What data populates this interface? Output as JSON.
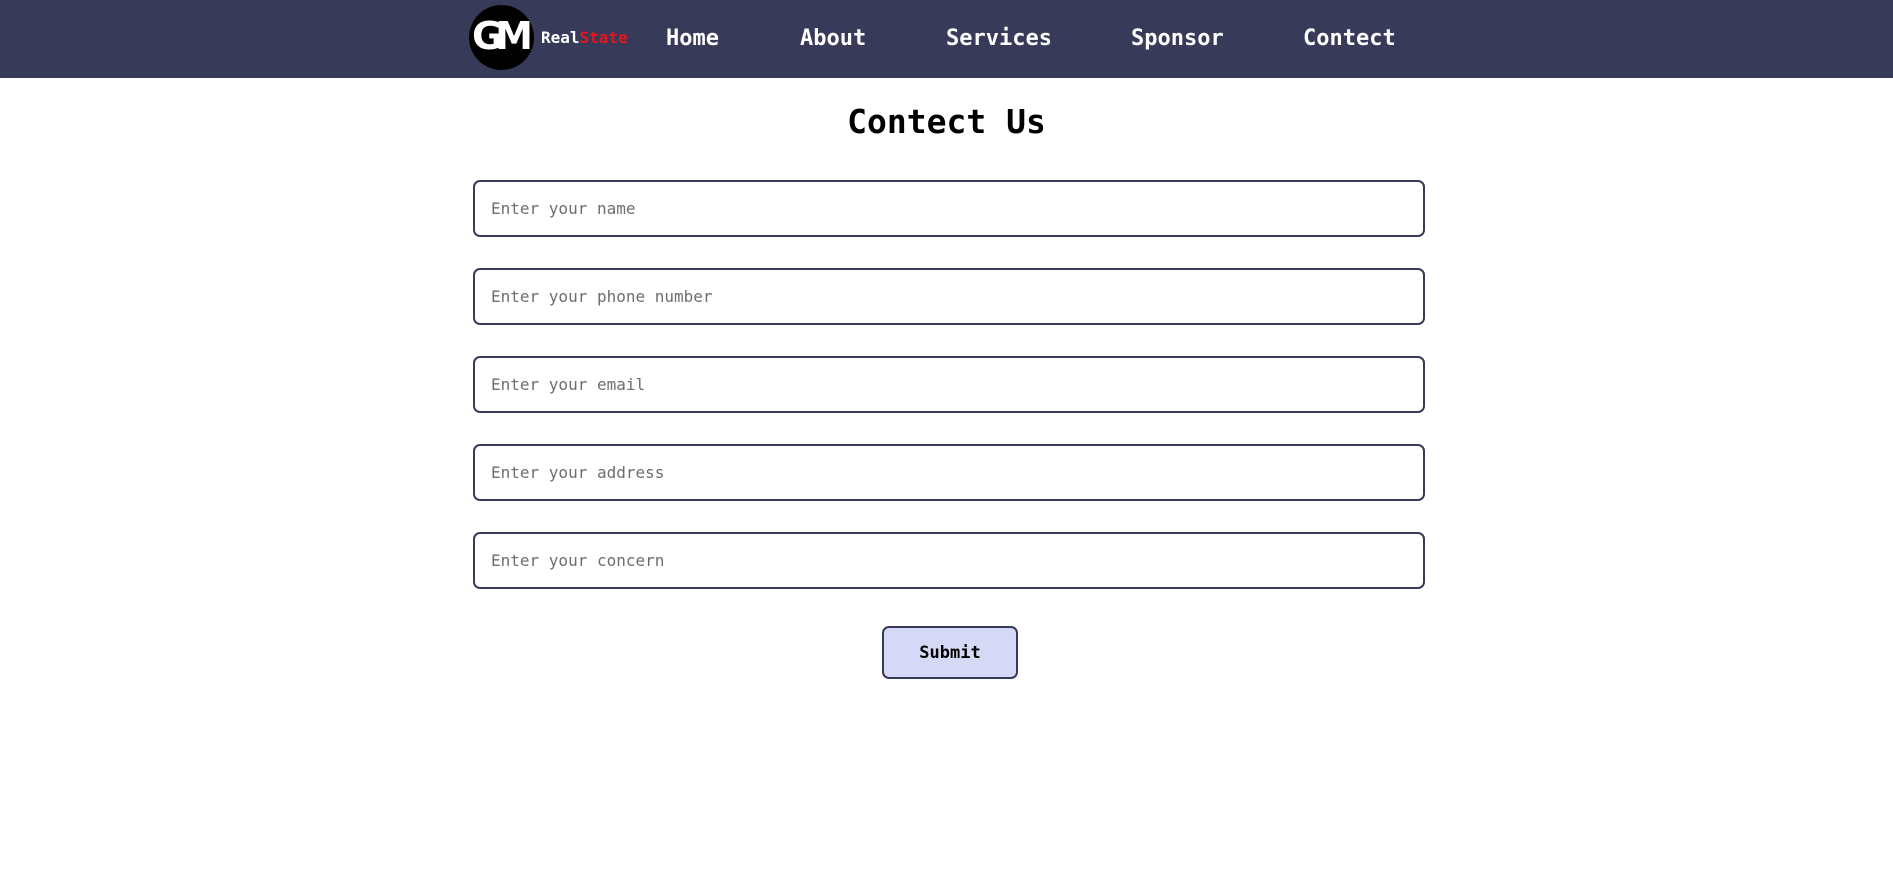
{
  "brand": {
    "logo_text": "GM",
    "name_part1": "Real",
    "name_part2": "State"
  },
  "nav": {
    "items": [
      {
        "label": "Home"
      },
      {
        "label": "About"
      },
      {
        "label": "Services"
      },
      {
        "label": "Sponsor"
      },
      {
        "label": "Contect"
      }
    ]
  },
  "page": {
    "title": "Contect Us"
  },
  "form": {
    "name_placeholder": "Enter your name",
    "phone_placeholder": "Enter your phone number",
    "email_placeholder": "Enter your email",
    "address_placeholder": "Enter your address",
    "concern_placeholder": "Enter your concern",
    "submit_label": "Submit"
  },
  "colors": {
    "navbar_bg": "#383a59",
    "brand_accent": "#e8141c",
    "submit_bg": "#d6d9f5",
    "field_border": "#383a59"
  }
}
